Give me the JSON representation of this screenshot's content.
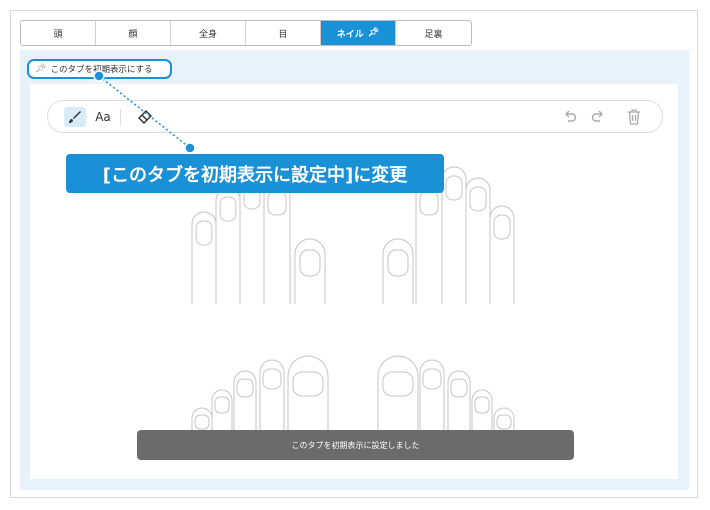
{
  "tabs": [
    {
      "label": "頭",
      "active": false
    },
    {
      "label": "顔",
      "active": false
    },
    {
      "label": "全身",
      "active": false
    },
    {
      "label": "目",
      "active": false
    },
    {
      "label": "ネイル",
      "active": true,
      "pinned": true
    },
    {
      "label": "足裏",
      "active": false
    }
  ],
  "pin_default": {
    "label": "このタブを初期表示にする",
    "icon": "pin-icon"
  },
  "toolbar": {
    "text_tool_label": "Aa",
    "icons": [
      "brush-icon",
      "eraser-icon",
      "undo-icon",
      "redo-icon",
      "trash-icon"
    ]
  },
  "callout": {
    "text": "[このタブを初期表示に設定中]に変更"
  },
  "toast": {
    "text": "このタブを初期表示に設定しました"
  },
  "colors": {
    "accent": "#1a90d6",
    "panel_bg": "#e8f2fa",
    "toast_bg": "#6b6b6b"
  }
}
